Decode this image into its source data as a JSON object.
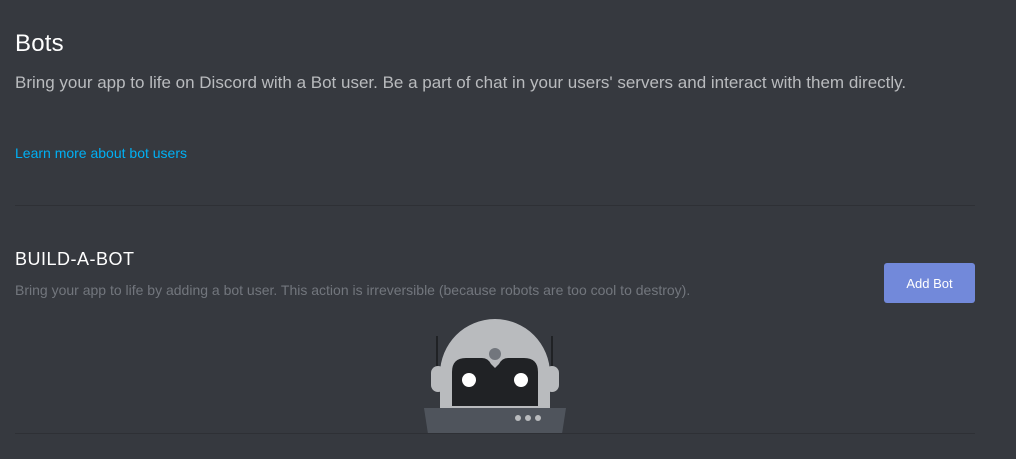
{
  "header": {
    "title": "Bots",
    "description": "Bring your app to life on Discord with a Bot user. Be a part of chat in your users' servers and interact with them directly.",
    "learn_more_link": "Learn more about bot users"
  },
  "build_a_bot": {
    "title": "BUILD-A-BOT",
    "description": "Bring your app to life by adding a bot user. This action is irreversible (because robots are too cool to destroy).",
    "add_button_label": "Add Bot"
  },
  "illustration": {
    "icon": "robot-illustration-icon"
  },
  "colors": {
    "background": "#36393f",
    "accent": "#7289da",
    "link": "#00b0f4",
    "muted_text": "#72767d"
  }
}
